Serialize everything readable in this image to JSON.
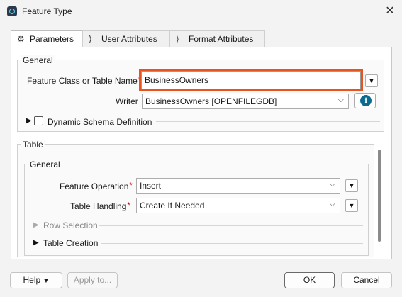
{
  "window": {
    "title": "Feature Type",
    "close_glyph": "✕"
  },
  "tabs": [
    {
      "label": "Parameters",
      "icon": "gear-icon",
      "glyph": "⚙",
      "active": true
    },
    {
      "label": "User Attributes",
      "icon": "chevron-tag-icon",
      "glyph": "⟩",
      "active": false
    },
    {
      "label": "Format Attributes",
      "icon": "chevron-tag-icon",
      "glyph": "⟩",
      "active": false
    }
  ],
  "general": {
    "title": "General",
    "feature_class_label": "Feature Class or Table Name",
    "feature_class_value": "BusinessOwners",
    "writer_label": "Writer",
    "writer_value": "BusinessOwners [OPENFILEGDB]",
    "dynamic_schema_label": "Dynamic Schema Definition",
    "dynamic_schema_checked": false
  },
  "table": {
    "title": "Table",
    "general_title": "General",
    "feature_operation_label": "Feature Operation",
    "feature_operation_value": "Insert",
    "table_handling_label": "Table Handling",
    "table_handling_value": "Create If Needed",
    "row_selection_label": "Row Selection",
    "table_creation_label": "Table Creation"
  },
  "footer": {
    "help_label": "Help",
    "apply_label": "Apply to...",
    "ok_label": "OK",
    "cancel_label": "Cancel"
  },
  "colors": {
    "highlight": "#e8531e",
    "required": "#c00000",
    "info": "#0a6b8f"
  }
}
